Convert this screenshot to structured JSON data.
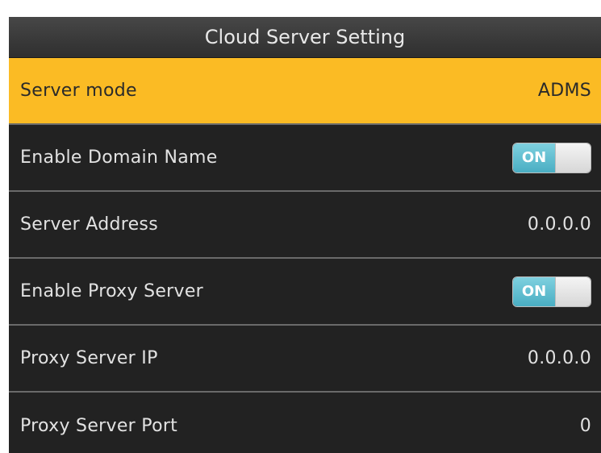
{
  "title": "Cloud Server Setting",
  "rows": [
    {
      "label": "Server mode",
      "value": "ADMS"
    },
    {
      "label": "Enable Domain Name",
      "toggle": "ON"
    },
    {
      "label": "Server Address",
      "value": "0.0.0.0"
    },
    {
      "label": "Enable Proxy Server",
      "toggle": "ON"
    },
    {
      "label": "Proxy Server IP",
      "value": "0.0.0.0"
    },
    {
      "label": "Proxy Server Port",
      "value": "0"
    }
  ],
  "colors": {
    "selected_row": "#fbbb24",
    "background": "#222222",
    "toggle_on": "#4aaec3"
  }
}
